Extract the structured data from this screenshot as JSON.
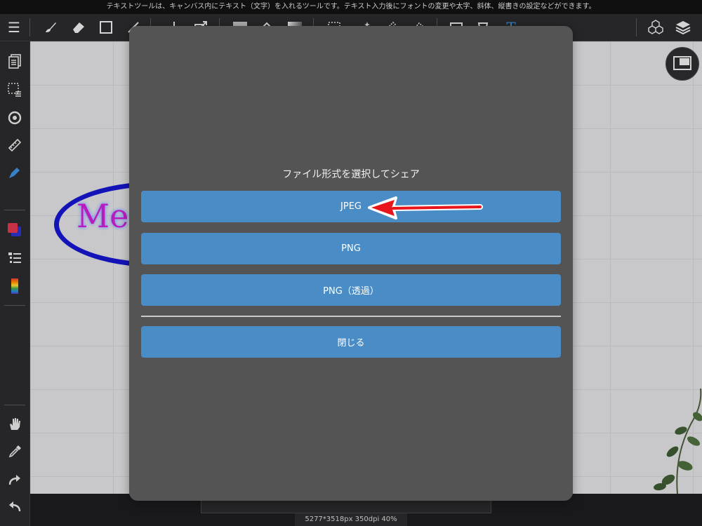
{
  "tip_bar": {
    "text": "テキストツールは、キャンバス内にテキスト（文字）を入れるツールです。テキスト入力後にフォントの変更や太字、斜体、縦書きの設定などができます。"
  },
  "toolbar": {
    "icons": [
      "menu-icon",
      "brush-icon",
      "eraser-icon",
      "rectangle-icon",
      "transform-icon",
      "move-icon",
      "resize-icon",
      "fill-color-icon",
      "bucket-icon",
      "gradient-icon",
      "select-rect-icon",
      "magic-wand-icon",
      "select-pen-icon",
      "select-eraser-icon",
      "frame-icon",
      "text-icon",
      "materials-icon",
      "layers-icon"
    ],
    "text_tool_glyph": "T"
  },
  "sidebar": {
    "icons": [
      "pages-icon",
      "selection-menu-icon",
      "rotate-snap-icon",
      "ruler-icon",
      "filter-icon",
      "color-icon",
      "layer-list-icon",
      "color-palette-icon",
      "hand-icon",
      "eyedropper-icon",
      "redo-icon",
      "undo-icon"
    ]
  },
  "canvas": {
    "text_fragment": "Me",
    "ellipse_color": "#1515c8",
    "text_color": "#c81fd0"
  },
  "modal": {
    "title": "ファイル形式を選択してシェア",
    "buttons": {
      "jpeg": "JPEG",
      "png": "PNG",
      "png_transparent": "PNG（透過）",
      "close": "閉じる"
    },
    "button_color": "#4a8dc6",
    "background_color": "#545454"
  },
  "annotation": {
    "arrow_color": "#e8151b",
    "points_to": "JPEG"
  },
  "status": {
    "text": "5277*3518px 350dpi 40%"
  }
}
